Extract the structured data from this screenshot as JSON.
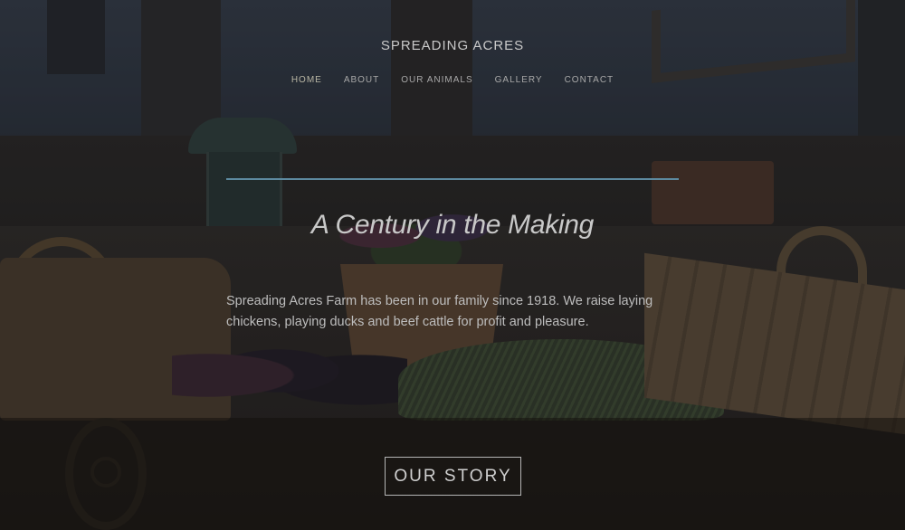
{
  "site": {
    "title": "SPREADING ACRES"
  },
  "nav": {
    "items": [
      {
        "label": "HOME",
        "active": true
      },
      {
        "label": "ABOUT",
        "active": false
      },
      {
        "label": "OUR ANIMALS",
        "active": false
      },
      {
        "label": "GALLERY",
        "active": false
      },
      {
        "label": "CONTACT",
        "active": false
      }
    ]
  },
  "hero": {
    "headline": "A Century in the Making",
    "intro": "Spreading Acres Farm has been in our family since 1918. We raise laying chickens, playing ducks and beef cattle for profit and pleasure.",
    "cta_label": "OUR STORY",
    "accent_color": "#5d8aa0"
  }
}
